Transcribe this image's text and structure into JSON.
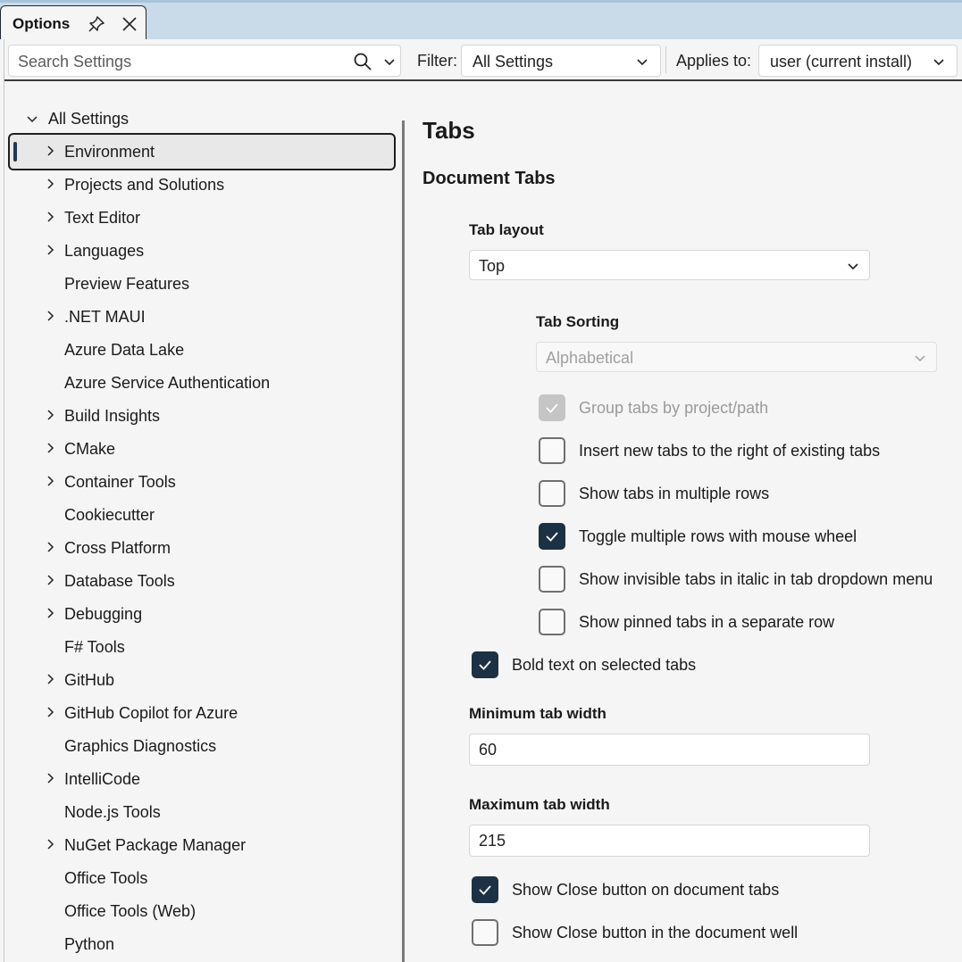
{
  "window": {
    "tab_title": "Options",
    "pin_icon": "pin-icon",
    "close_icon": "close-icon"
  },
  "toolbar": {
    "search_placeholder": "Search Settings",
    "search_icon": "search-icon",
    "filter_label": "Filter:",
    "filter_value": "All Settings",
    "applies_label": "Applies to:",
    "applies_value": "user (current install)"
  },
  "tree": {
    "root_label": "All Settings",
    "items": [
      {
        "label": "Environment",
        "expandable": true,
        "selected": true
      },
      {
        "label": "Projects and Solutions",
        "expandable": true
      },
      {
        "label": "Text Editor",
        "expandable": true
      },
      {
        "label": "Languages",
        "expandable": true
      },
      {
        "label": "Preview Features",
        "expandable": false
      },
      {
        "label": ".NET MAUI",
        "expandable": true
      },
      {
        "label": "Azure Data Lake",
        "expandable": false
      },
      {
        "label": "Azure Service Authentication",
        "expandable": false
      },
      {
        "label": "Build Insights",
        "expandable": true
      },
      {
        "label": "CMake",
        "expandable": true
      },
      {
        "label": "Container Tools",
        "expandable": true
      },
      {
        "label": "Cookiecutter",
        "expandable": false
      },
      {
        "label": "Cross Platform",
        "expandable": true
      },
      {
        "label": "Database Tools",
        "expandable": true
      },
      {
        "label": "Debugging",
        "expandable": true
      },
      {
        "label": "F# Tools",
        "expandable": false
      },
      {
        "label": "GitHub",
        "expandable": true
      },
      {
        "label": "GitHub Copilot for Azure",
        "expandable": true
      },
      {
        "label": "Graphics Diagnostics",
        "expandable": false
      },
      {
        "label": "IntelliCode",
        "expandable": true
      },
      {
        "label": "Node.js Tools",
        "expandable": false
      },
      {
        "label": "NuGet Package Manager",
        "expandable": true
      },
      {
        "label": "Office Tools",
        "expandable": false
      },
      {
        "label": "Office Tools (Web)",
        "expandable": false
      },
      {
        "label": "Python",
        "expandable": false
      }
    ]
  },
  "content": {
    "page_title": "Tabs",
    "section_title": "Document Tabs",
    "tab_layout": {
      "label": "Tab layout",
      "value": "Top"
    },
    "tab_sorting": {
      "label": "Tab Sorting",
      "value": "Alphabetical",
      "disabled": true
    },
    "checkboxes_nested": [
      {
        "label": "Group tabs by project/path",
        "checked": true,
        "disabled": true
      },
      {
        "label": "Insert new tabs to the right of existing tabs",
        "checked": false
      },
      {
        "label": "Show tabs in multiple rows",
        "checked": false
      },
      {
        "label": "Toggle multiple rows with mouse wheel",
        "checked": true
      },
      {
        "label": "Show invisible tabs in italic in tab dropdown menu",
        "checked": false
      },
      {
        "label": "Show pinned tabs in a separate row",
        "checked": false
      }
    ],
    "bold_text": {
      "label": "Bold text on selected tabs",
      "checked": true
    },
    "min_width": {
      "label": "Minimum tab width",
      "value": "60"
    },
    "max_width": {
      "label": "Maximum tab width",
      "value": "215"
    },
    "checkboxes_bottom": [
      {
        "label": "Show Close button on document tabs",
        "checked": true
      },
      {
        "label": "Show Close button in the document well",
        "checked": false
      }
    ]
  },
  "colors": {
    "accent": "#1c3144",
    "tabstrip": "#c9dbe9",
    "background": "#f5f5f5"
  }
}
